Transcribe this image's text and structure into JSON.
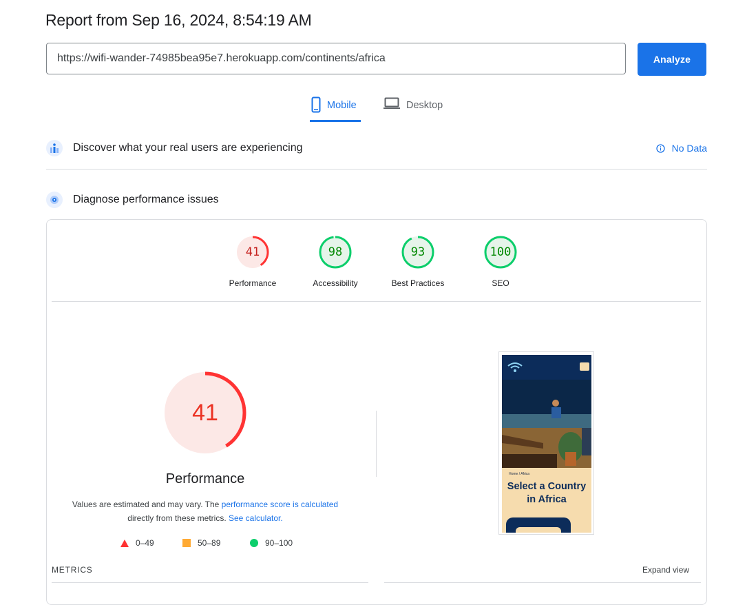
{
  "report": {
    "title": "Report from Sep 16, 2024, 8:54:19 AM"
  },
  "url_bar": {
    "value": "https://wifi-wander-74985bea95e7.herokuapp.com/continents/africa"
  },
  "analyze_button": {
    "label": "Analyze"
  },
  "tabs": [
    {
      "label": "Mobile",
      "active": true,
      "icon": "smartphone-icon"
    },
    {
      "label": "Desktop",
      "active": false,
      "icon": "laptop-icon"
    }
  ],
  "crux": {
    "title": "Discover what your real users are experiencing",
    "status": "No Data"
  },
  "diagnose": {
    "title": "Diagnose performance issues"
  },
  "categories": [
    {
      "label": "Performance",
      "score": "41",
      "fraction": 0.41,
      "color": "#ff3333",
      "bg": "#fce8e6"
    },
    {
      "label": "Accessibility",
      "score": "98",
      "fraction": 0.98,
      "color": "#0cce6b",
      "bg": "#e6f4ea"
    },
    {
      "label": "Best Practices",
      "score": "93",
      "fraction": 0.93,
      "color": "#0cce6b",
      "bg": "#e6f4ea"
    },
    {
      "label": "SEO",
      "score": "100",
      "fraction": 1.0,
      "color": "#0cce6b",
      "bg": "#e6f4ea"
    }
  ],
  "performance": {
    "score": "41",
    "fraction": 0.41,
    "title": "Performance",
    "desc_1": "Values are estimated and may vary. The ",
    "desc_link_1": "performance score is calculated",
    "desc_2": "directly from these metrics. ",
    "desc_link_2": "See calculator."
  },
  "legend": [
    {
      "range": "0–49",
      "shape": "triangle",
      "color": "#ff3333"
    },
    {
      "range": "50–89",
      "shape": "square",
      "color": "#ffaa33"
    },
    {
      "range": "90–100",
      "shape": "circle",
      "color": "#0cce6b"
    }
  ],
  "screenshot": {
    "breadcrumb": "Home / Africa",
    "heading": "Select a Country in Africa"
  },
  "metrics": {
    "label": "METRICS",
    "expand": "Expand view"
  }
}
